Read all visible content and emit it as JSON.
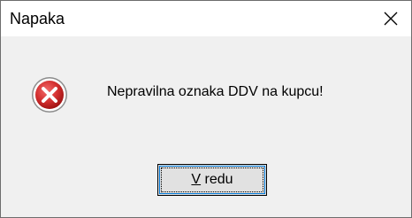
{
  "window": {
    "title": "Napaka",
    "close_icon": "close-icon"
  },
  "dialog": {
    "icon": "error-icon",
    "message": "Nepravilna oznaka DDV na kupcu!",
    "ok_button": {
      "mnemonic": "V",
      "label_rest": " redu"
    }
  },
  "colors": {
    "error_red": "#d32f2f",
    "dialog_bg": "#f0f0f0",
    "button_bg": "#e1e1e1",
    "focus_blue": "#0078d7"
  }
}
